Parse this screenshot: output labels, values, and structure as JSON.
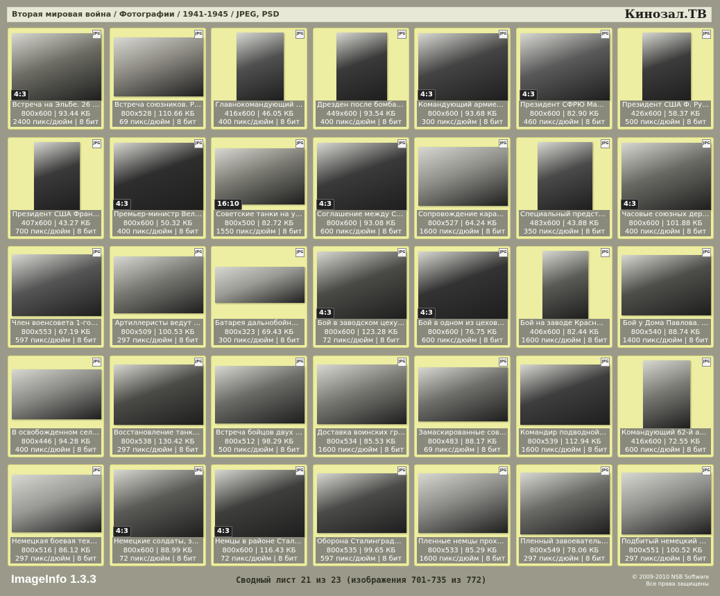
{
  "header": {
    "breadcrumb": "Вторая мировая война / Фотографии / 1941-1945 / JPEG, PSD",
    "brand": "Кинозал.ТВ"
  },
  "footer": {
    "app_name": "ImageInfo 1.3.3",
    "sheet_info": "Сводный лист 21 из 23 (изображения 701-735 из 772)",
    "copyright_line1": "© 2009-2010 NSB Software",
    "copyright_line2": "Все права защищены"
  },
  "file_type_badge": "JPG",
  "tiles": [
    {
      "title": "Встреча на Эльбе. 26 …",
      "dims": "800x600 | 93.44 КБ",
      "meta": "2400 пикс/дюйм | 8 бит",
      "ratio": "4:3",
      "aspect": 1.333,
      "tone": "#6d6d64"
    },
    {
      "title": "Встреча союзников. Р…",
      "dims": "800x528 | 110.66 КБ",
      "meta": "69 пикс/дюйм | 8 бит",
      "ratio": "",
      "aspect": 1.515,
      "tone": "#8a8880"
    },
    {
      "title": "Главнокомандующий …",
      "dims": "416x600 | 46.05 КБ",
      "meta": "400 пикс/дюйм | 8 бит",
      "ratio": "",
      "aspect": 0.693,
      "tone": "#505050"
    },
    {
      "title": "Дрезден после бомбар…",
      "dims": "449x600 | 93.54 КБ",
      "meta": "400 пикс/дюйм | 8 бит",
      "ratio": "",
      "aspect": 0.748,
      "tone": "#3a3a3a"
    },
    {
      "title": "Командующий армией…",
      "dims": "800x600 | 93.68 КБ",
      "meta": "300 пикс/дюйм | 8 бит",
      "ratio": "4:3",
      "aspect": 1.333,
      "tone": "#444"
    },
    {
      "title": "Президент СФРЮ Мар…",
      "dims": "800x600 | 82.90 КБ",
      "meta": "460 пикс/дюйм | 8 бит",
      "ratio": "4:3",
      "aspect": 1.333,
      "tone": "#5a5a5a"
    },
    {
      "title": "Президент США Ф. Ру…",
      "dims": "426x600 | 58.37 КБ",
      "meta": "500 пикс/дюйм | 8 бит",
      "ratio": "",
      "aspect": 0.71,
      "tone": "#3c3c3c"
    },
    {
      "title": "Президент США Фран…",
      "dims": "407x600 | 43.27 КБ",
      "meta": "700 пикс/дюйм | 8 бит",
      "ratio": "",
      "aspect": 0.678,
      "tone": "#3a3a3a"
    },
    {
      "title": "Премьер-министр Вели…",
      "dims": "800x600 | 50.32 КБ",
      "meta": "400 пикс/дюйм | 8 бит",
      "ratio": "4:3",
      "aspect": 1.333,
      "tone": "#2e2e2e"
    },
    {
      "title": "Советские танки на у…",
      "dims": "800x500 | 82.72 КБ",
      "meta": "1550 пикс/дюйм | 8 бит",
      "ratio": "16:10",
      "aspect": 1.6,
      "tone": "#7a7a72"
    },
    {
      "title": "Соглашение между СС…",
      "dims": "800x600 | 93.08 КБ",
      "meta": "600 пикс/дюйм | 8 бит",
      "ratio": "4:3",
      "aspect": 1.333,
      "tone": "#3a3a3a"
    },
    {
      "title": "Сопровождение карав…",
      "dims": "800x527 | 64.24 КБ",
      "meta": "1600 пикс/дюйм | 8 бит",
      "ratio": "",
      "aspect": 1.518,
      "tone": "#8e8e88"
    },
    {
      "title": "Специальный предста…",
      "dims": "483x600 | 43.88 КБ",
      "meta": "350 пикс/дюйм | 8 бит",
      "ratio": "",
      "aspect": 0.805,
      "tone": "#4a4a4a"
    },
    {
      "title": "Часовые союзных дер…",
      "dims": "800x600 | 101.88 КБ",
      "meta": "400 пикс/дюйм | 8 бит",
      "ratio": "4:3",
      "aspect": 1.333,
      "tone": "#6a6a64"
    },
    {
      "title": "Член военсовета 1-го …",
      "dims": "800x553 | 67.19 КБ",
      "meta": "597 пикс/дюйм | 8 бит",
      "ratio": "",
      "aspect": 1.447,
      "tone": "#555"
    },
    {
      "title": "Артиллеристы ведут …",
      "dims": "800x509 | 100.53 КБ",
      "meta": "297 пикс/дюйм | 8 бит",
      "ratio": "",
      "aspect": 1.572,
      "tone": "#7a7a74"
    },
    {
      "title": "Батарея дальнобойны…",
      "dims": "800x323 | 69.43 КБ",
      "meta": "300 пикс/дюйм | 8 бит",
      "ratio": "",
      "aspect": 2.477,
      "tone": "#9a9a94"
    },
    {
      "title": "Бой в заводском цеху…",
      "dims": "800x600 | 123.28 КБ",
      "meta": "72 пикс/дюйм | 8 бит",
      "ratio": "4:3",
      "aspect": 1.333,
      "tone": "#4a4a46"
    },
    {
      "title": "Бой в одном из цехов …",
      "dims": "800x600 | 76.75 КБ",
      "meta": "600 пикс/дюйм | 8 бит",
      "ratio": "4:3",
      "aspect": 1.333,
      "tone": "#333"
    },
    {
      "title": "Бой на заводе Красны…",
      "dims": "406x600 | 82.44 КБ",
      "meta": "1600 пикс/дюйм | 8 бит",
      "ratio": "",
      "aspect": 0.677,
      "tone": "#5a5a56"
    },
    {
      "title": "Бой у Дома Павлова. …",
      "dims": "800x540 | 88.74 КБ",
      "meta": "1400 пикс/дюйм | 8 бит",
      "ratio": "",
      "aspect": 1.481,
      "tone": "#4e4e4a"
    },
    {
      "title": "В освобожденном селе…",
      "dims": "800x446 | 94.28 КБ",
      "meta": "400 пикс/дюйм | 8 бит",
      "ratio": "",
      "aspect": 1.794,
      "tone": "#8a8a86"
    },
    {
      "title": "Восстановление танко…",
      "dims": "800x538 | 130.42 КБ",
      "meta": "297 пикс/дюйм | 8 бит",
      "ratio": "",
      "aspect": 1.487,
      "tone": "#4a4a46"
    },
    {
      "title": "Встреча бойцов двух …",
      "dims": "800x512 | 98.29 КБ",
      "meta": "500 пикс/дюйм | 8 бит",
      "ratio": "",
      "aspect": 1.5625,
      "tone": "#6a6a66"
    },
    {
      "title": "Доставка воинских гр…",
      "dims": "800x534 | 85.53 КБ",
      "meta": "1600 пикс/дюйм | 8 бит",
      "ratio": "",
      "aspect": 1.498,
      "tone": "#7a7a74"
    },
    {
      "title": "Замаскированные сов…",
      "dims": "800x483 | 88.17 КБ",
      "meta": "69 пикс/дюйм | 8 бит",
      "ratio": "",
      "aspect": 1.656,
      "tone": "#6e6e6a"
    },
    {
      "title": "Командир подводной …",
      "dims": "800x539 | 112.94 КБ",
      "meta": "1600 пикс/дюйм | 8 бит",
      "ratio": "",
      "aspect": 1.484,
      "tone": "#3e3e3e"
    },
    {
      "title": "Командующий 62-й ар…",
      "dims": "416x600 | 72.55 КБ",
      "meta": "600 пикс/дюйм | 8 бит",
      "ratio": "",
      "aspect": 0.693,
      "tone": "#7a7a74"
    },
    {
      "title": "Немецкая боевая техн…",
      "dims": "800x516 | 86.12 КБ",
      "meta": "297 пикс/дюйм | 8 бит",
      "ratio": "",
      "aspect": 1.55,
      "tone": "#9a9a96"
    },
    {
      "title": "Немецкие солдаты, за…",
      "dims": "800x600 | 88.99 КБ",
      "meta": "72 пикс/дюйм | 8 бит",
      "ratio": "4:3",
      "aspect": 1.333,
      "tone": "#5a5a56"
    },
    {
      "title": "Немцы в районе Стали…",
      "dims": "800x600 | 116.43 КБ",
      "meta": "72 пикс/дюйм | 8 бит",
      "ratio": "4:3",
      "aspect": 1.333,
      "tone": "#3e3e3c"
    },
    {
      "title": "Оборона Сталинграда…",
      "dims": "800x535 | 99.65 КБ",
      "meta": "597 пикс/дюйм | 8 бит",
      "ratio": "",
      "aspect": 1.495,
      "tone": "#4a4a48"
    },
    {
      "title": "Пленные немцы прохо…",
      "dims": "800x533 | 85.29 КБ",
      "meta": "1600 пикс/дюйм | 8 бит",
      "ratio": "",
      "aspect": 1.501,
      "tone": "#8a8a86"
    },
    {
      "title": "Пленный завоеватель…",
      "dims": "800x549 | 78.06 КБ",
      "meta": "297 пикс/дюйм | 8 бит",
      "ratio": "",
      "aspect": 1.457,
      "tone": "#6a6a66"
    },
    {
      "title": "Подбитый немецкий т…",
      "dims": "800x551 | 100.52 КБ",
      "meta": "297 пикс/дюйм | 8 бит",
      "ratio": "",
      "aspect": 1.452,
      "tone": "#8e8e8a"
    }
  ]
}
